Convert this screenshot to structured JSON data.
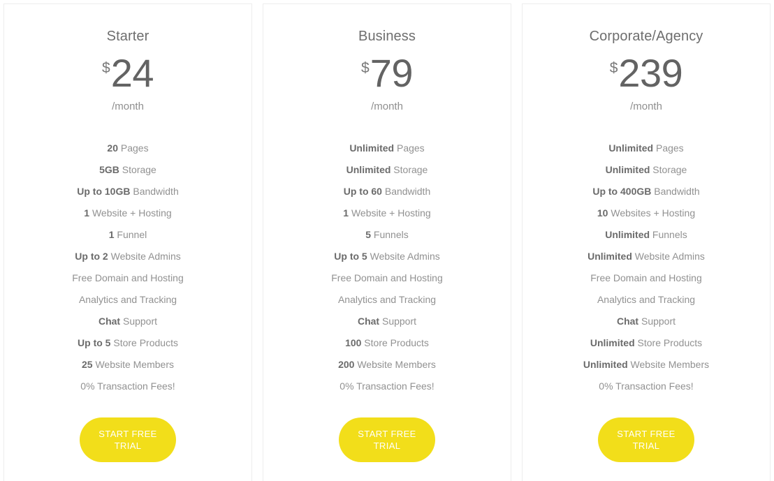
{
  "theme": {
    "accent_yellow": "#F2DE1A",
    "card_border": "#ededed",
    "text_muted": "#919191",
    "text_strong": "#6b6b6b",
    "title_color": "#6e6e6e"
  },
  "plans": [
    {
      "name": "Starter",
      "currency": "$",
      "price": "24",
      "period": "/month",
      "features": [
        {
          "strong": "20",
          "rest": " Pages"
        },
        {
          "strong": "5GB",
          "rest": " Storage"
        },
        {
          "strong": "Up to 10GB",
          "rest": " Bandwidth"
        },
        {
          "strong": "1",
          "rest": " Website + Hosting"
        },
        {
          "strong": "1",
          "rest": " Funnel"
        },
        {
          "strong": "Up to 2",
          "rest": " Website Admins"
        },
        {
          "strong": "",
          "rest": "Free Domain and Hosting"
        },
        {
          "strong": "",
          "rest": "Analytics and Tracking"
        },
        {
          "strong": "Chat",
          "rest": " Support"
        },
        {
          "strong": "Up to 5",
          "rest": " Store Products"
        },
        {
          "strong": "25",
          "rest": " Website Members"
        },
        {
          "strong": "",
          "rest": "0% Transaction Fees!"
        }
      ],
      "cta_label": "Start Free Trial"
    },
    {
      "name": "Business",
      "currency": "$",
      "price": "79",
      "period": "/month",
      "features": [
        {
          "strong": "Unlimited",
          "rest": " Pages"
        },
        {
          "strong": "Unlimited",
          "rest": " Storage"
        },
        {
          "strong": "Up to 60",
          "rest": " Bandwidth"
        },
        {
          "strong": "1",
          "rest": " Website + Hosting"
        },
        {
          "strong": "5",
          "rest": " Funnels"
        },
        {
          "strong": "Up to 5",
          "rest": " Website Admins"
        },
        {
          "strong": "",
          "rest": "Free Domain and Hosting"
        },
        {
          "strong": "",
          "rest": "Analytics and Tracking"
        },
        {
          "strong": "Chat",
          "rest": " Support"
        },
        {
          "strong": "100",
          "rest": " Store Products"
        },
        {
          "strong": "200",
          "rest": " Website Members"
        },
        {
          "strong": "",
          "rest": "0% Transaction Fees!"
        }
      ],
      "cta_label": "Start Free Trial"
    },
    {
      "name": "Corporate/Agency",
      "currency": "$",
      "price": "239",
      "period": "/month",
      "features": [
        {
          "strong": "Unlimited",
          "rest": " Pages"
        },
        {
          "strong": "Unlimited",
          "rest": " Storage"
        },
        {
          "strong": "Up to 400GB",
          "rest": " Bandwidth"
        },
        {
          "strong": "10",
          "rest": " Websites + Hosting"
        },
        {
          "strong": "Unlimited",
          "rest": " Funnels"
        },
        {
          "strong": "Unlimited",
          "rest": " Website Admins"
        },
        {
          "strong": "",
          "rest": "Free Domain and Hosting"
        },
        {
          "strong": "",
          "rest": "Analytics and Tracking"
        },
        {
          "strong": "Chat",
          "rest": " Support"
        },
        {
          "strong": "Unlimited",
          "rest": " Store Products"
        },
        {
          "strong": "Unlimited",
          "rest": " Website Members"
        },
        {
          "strong": "",
          "rest": "0% Transaction Fees!"
        }
      ],
      "cta_label": "Start Free Trial"
    }
  ]
}
